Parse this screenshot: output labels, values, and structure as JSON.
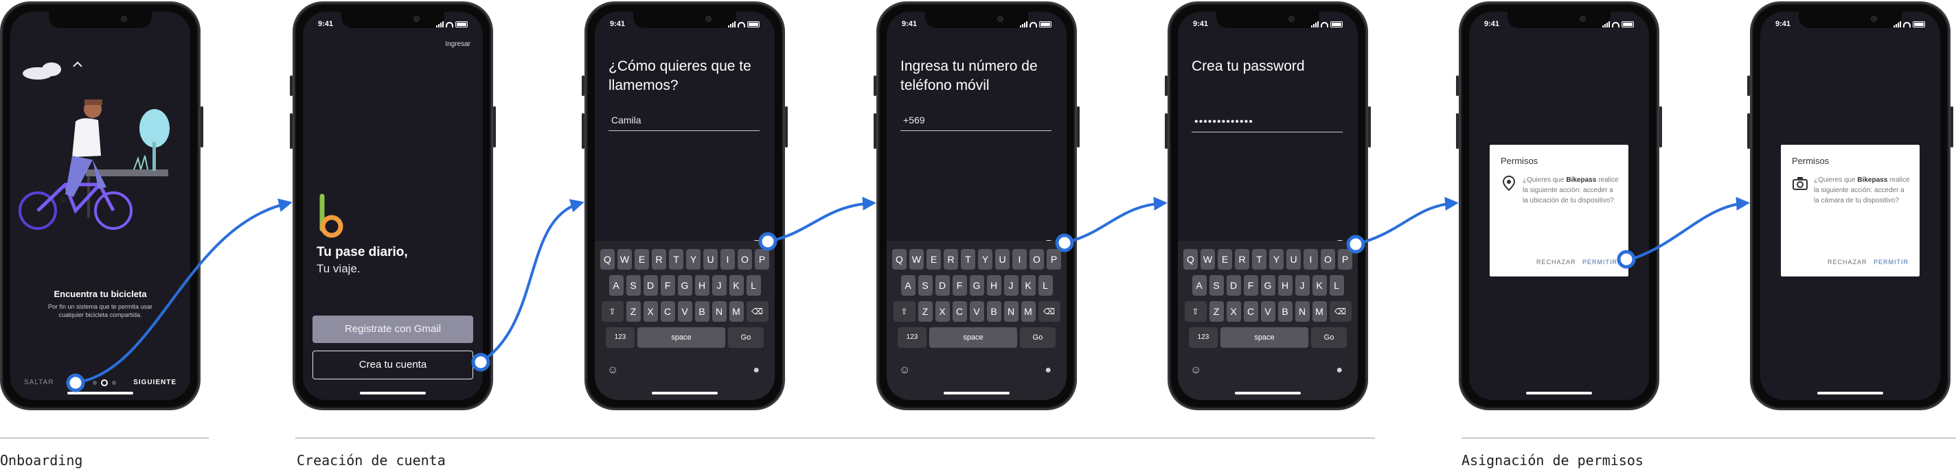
{
  "status_time": "9:41",
  "onboarding": {
    "title": "Encuentra tu bicicleta",
    "subtitle": "Por fin un sistema que te permita usar cualquier bicicleta compartida.",
    "skip": "SALTAR",
    "next": "SIGUIENTE"
  },
  "create": {
    "login": "Ingresar",
    "headline": "Tu pase diario,",
    "subhead": "Tu viaje.",
    "gmail_button": "Registrate con Gmail",
    "create_button": "Crea tu cuenta"
  },
  "name_screen": {
    "question": "¿Cómo quieres que te llamemos?",
    "value": "Camila"
  },
  "phone_screen": {
    "question": "Ingresa tu número de teléfono móvil",
    "value": "+569"
  },
  "password_screen": {
    "question": "Crea tu password",
    "value": "•••••••••••••"
  },
  "keyboard": {
    "row1": [
      "Q",
      "W",
      "E",
      "R",
      "T",
      "Y",
      "U",
      "I",
      "O",
      "P"
    ],
    "row2": [
      "A",
      "S",
      "D",
      "F",
      "G",
      "H",
      "J",
      "K",
      "L"
    ],
    "row3": [
      "Z",
      "X",
      "C",
      "V",
      "B",
      "N",
      "M"
    ],
    "n123": "123",
    "space": "space",
    "go": "Go"
  },
  "permission_location": {
    "title": "Permisos",
    "text_pre": "¿Quieres que ",
    "app": "Bikepass",
    "text_post": " realice la siguiente acción: acceder a la ubicación de tu dispositivo?",
    "reject": "RECHAZAR",
    "allow": "PERMITIR",
    "icon": "location-pin-icon"
  },
  "permission_camera": {
    "title": "Permisos",
    "text_pre": "¿Quieres que ",
    "app": "Bikepass",
    "text_post": " realice la siguiente acción: acceder a la cámara de tu dispositivo?",
    "reject": "RECHAZAR",
    "allow": "PERMITIR",
    "icon": "camera-icon"
  },
  "sections": {
    "onboarding": "Onboarding",
    "account": "Creación de cuenta",
    "permissions": "Asignación de permisos"
  },
  "colors": {
    "flow_arrow": "#2a6fdb",
    "screen_bg": "#1b1a22",
    "accent_green": "#8bc34a",
    "accent_orange": "#f39c3d"
  }
}
